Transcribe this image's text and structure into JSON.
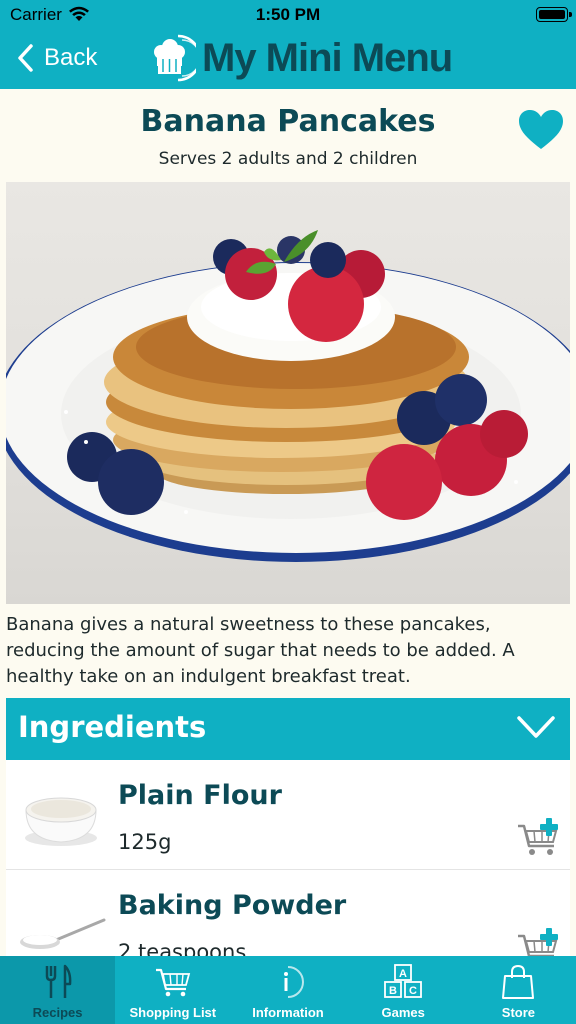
{
  "status": {
    "carrier": "Carrier",
    "time": "1:50 PM"
  },
  "nav": {
    "back_label": "Back",
    "app_title": "My Mini Menu"
  },
  "recipe": {
    "title": "Banana Pancakes",
    "serves": "Serves 2 adults and 2 children",
    "favorite": true,
    "description": "Banana gives a natural sweetness to these pancakes, reducing the amount of sugar that needs to be added. A healthy take on an indulgent breakfast treat."
  },
  "ingredients": {
    "header": "Ingredients",
    "items": [
      {
        "name": "Plain Flour",
        "quantity": "125g"
      },
      {
        "name": "Baking Powder",
        "quantity": "2 teaspoons"
      }
    ]
  },
  "tabs": [
    {
      "label": "Recipes",
      "icon": "fork-knife-icon",
      "active": true
    },
    {
      "label": "Shopping List",
      "icon": "cart-icon",
      "active": false
    },
    {
      "label": "Information",
      "icon": "info-icon",
      "active": false
    },
    {
      "label": "Games",
      "icon": "abc-blocks-icon",
      "active": false
    },
    {
      "label": "Store",
      "icon": "shopping-bag-icon",
      "active": false
    }
  ],
  "colors": {
    "accent": "#0fb0c3",
    "dark_teal": "#0c4a56",
    "background": "#fdfbf1"
  }
}
